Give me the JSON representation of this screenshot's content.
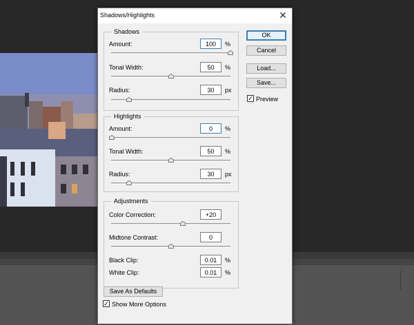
{
  "dialog": {
    "title": "Shadows/Highlights",
    "close_glyph": "✕"
  },
  "shadows": {
    "title": "Shadows",
    "amount": {
      "label": "Amount:",
      "value": "100",
      "unit": "%",
      "slider": 1.0
    },
    "tonal_width": {
      "label": "Tonal Width:",
      "value": "50",
      "unit": "%",
      "slider": 0.5
    },
    "radius": {
      "label": "Radius:",
      "value": "30",
      "unit": "px",
      "slider": 0.15
    }
  },
  "highlights": {
    "title": "Highlights",
    "amount": {
      "label": "Amount:",
      "value": "0",
      "unit": "%",
      "slider": 0.0
    },
    "tonal_width": {
      "label": "Tonal Width:",
      "value": "50",
      "unit": "%",
      "slider": 0.5
    },
    "radius": {
      "label": "Radius:",
      "value": "30",
      "unit": "px",
      "slider": 0.15
    }
  },
  "adjustments": {
    "title": "Adjustments",
    "color_correction": {
      "label": "Color Correction:",
      "value": "+20",
      "slider": 0.6
    },
    "midtone_contrast": {
      "label": "Midtone Contrast:",
      "value": "0",
      "slider": 0.5
    },
    "black_clip": {
      "label": "Black Clip:",
      "value": "0.01",
      "unit": "%"
    },
    "white_clip": {
      "label": "White Clip:",
      "value": "0.01",
      "unit": "%"
    }
  },
  "buttons": {
    "ok": "OK",
    "cancel": "Cancel",
    "load": "Load...",
    "save": "Save...",
    "save_defaults": "Save As Defaults"
  },
  "preview": {
    "label": "Preview",
    "checked": true
  },
  "more_options": {
    "label": "Show More Options",
    "checked": true
  },
  "colors": {
    "accent": "#3c7fb1"
  }
}
